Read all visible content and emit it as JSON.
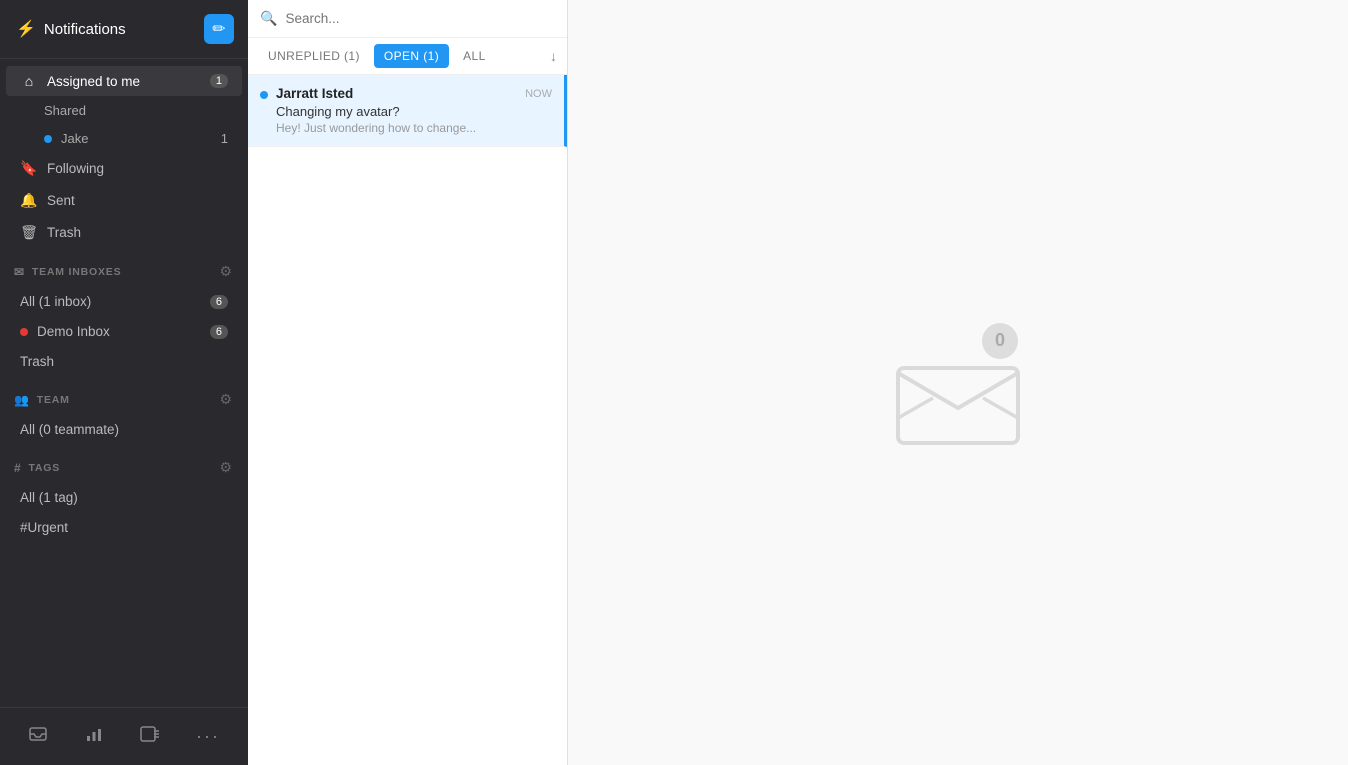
{
  "sidebar": {
    "header": {
      "title": "Notifications",
      "compose_label": "✏"
    },
    "personal": {
      "assigned_label": "Assigned to me",
      "assigned_count": "1",
      "shared_label": "Shared",
      "jake_label": "Jake",
      "jake_count": "1",
      "following_label": "Following",
      "sent_label": "Sent",
      "trash_label": "Trash"
    },
    "team_inboxes": {
      "section_label": "TEAM INBOXES",
      "all_label": "All (1 inbox)",
      "all_count": "6",
      "demo_inbox_label": "Demo Inbox",
      "demo_inbox_count": "6",
      "trash_label": "Trash"
    },
    "team": {
      "section_label": "TEAM",
      "all_label": "All (0 teammate)"
    },
    "tags": {
      "section_label": "TAGS",
      "all_label": "All (1 tag)",
      "urgent_label": "#Urgent"
    }
  },
  "search": {
    "placeholder": "Search..."
  },
  "tabs": {
    "unreplied_label": "UNREPLIED (1)",
    "open_label": "OPEN (1)",
    "all_label": "ALL"
  },
  "conversations": [
    {
      "sender": "Jarratt Isted",
      "time": "NOW",
      "subject": "Changing my avatar?",
      "preview": "Hey! Just wondering how to change...",
      "unread": true,
      "selected": true
    }
  ],
  "empty_state": {
    "badge": "0"
  },
  "footer": {
    "inbox_icon": "⬛",
    "stats_icon": "📊",
    "contacts_icon": "👤",
    "more_icon": "..."
  }
}
